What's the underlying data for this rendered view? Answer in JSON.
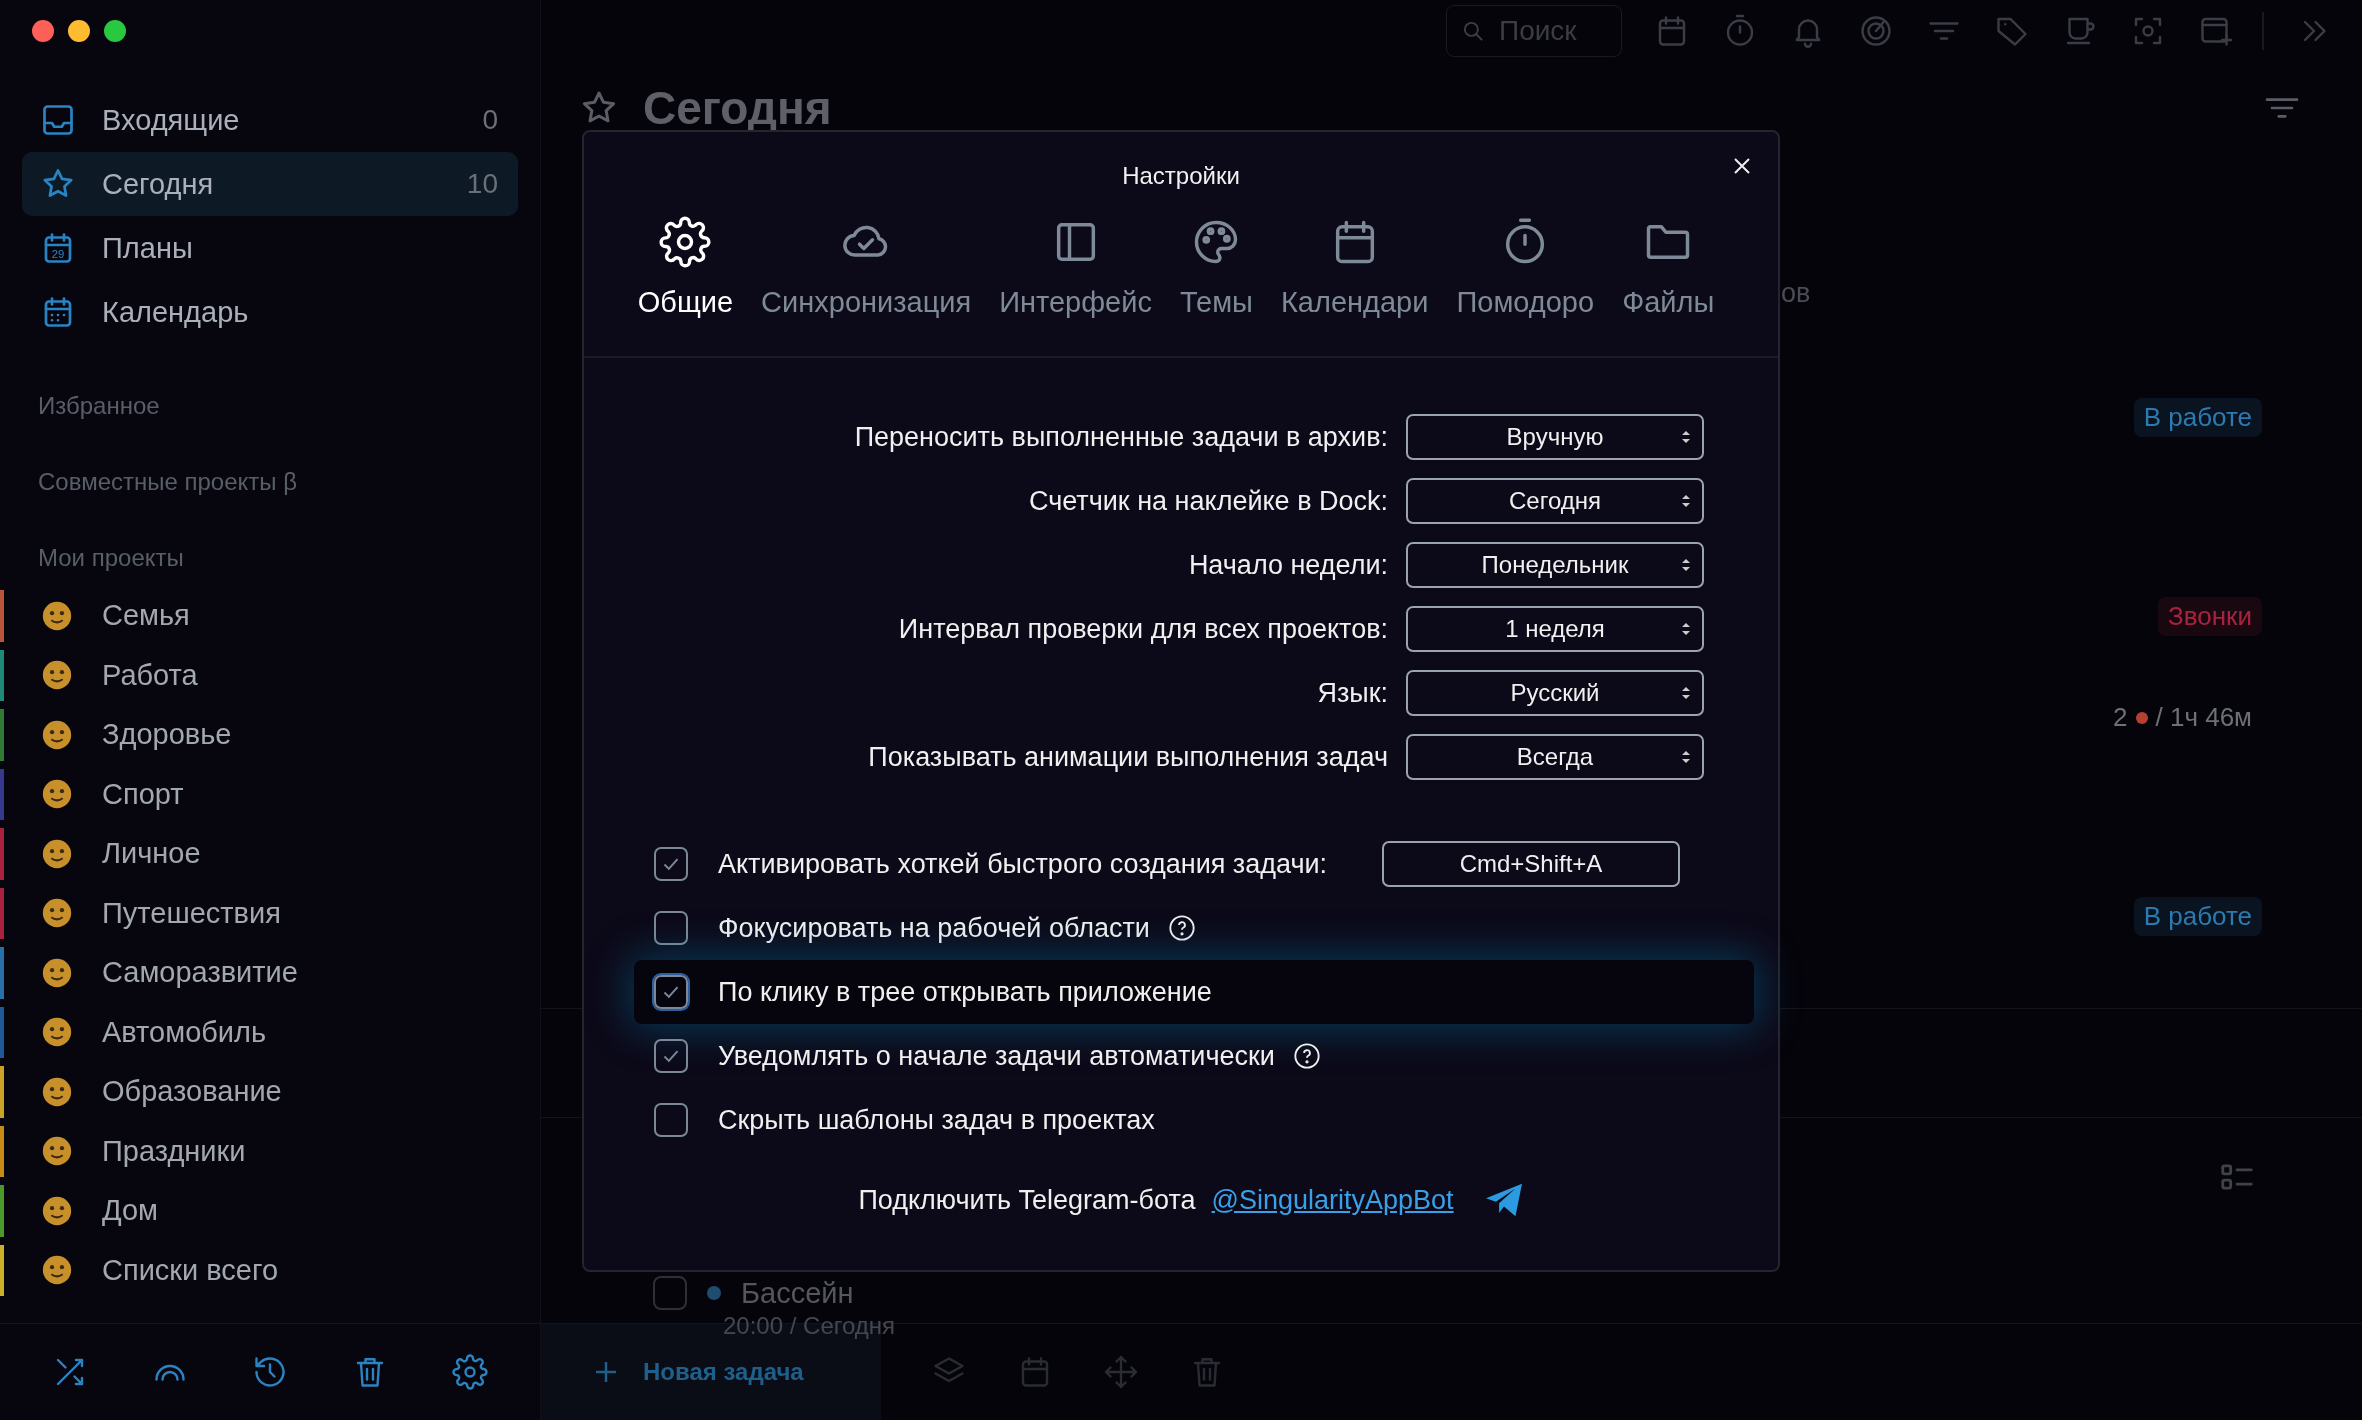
{
  "sidebar": {
    "nav": [
      {
        "kind": "inbox",
        "label": "Входящие",
        "count": "0",
        "selected": false
      },
      {
        "kind": "star",
        "label": "Сегодня",
        "count": "10",
        "selected": true
      },
      {
        "kind": "plans",
        "label": "Планы",
        "icon_text": "29",
        "selected": false
      },
      {
        "kind": "calendar",
        "label": "Календарь",
        "selected": false
      }
    ],
    "sections": [
      "Избранное",
      "Совместные проекты β"
    ],
    "projects_heading": "Мои проекты",
    "projects": [
      {
        "label": "Семья",
        "color": "#b8553a"
      },
      {
        "label": "Работа",
        "color": "#1f8a78"
      },
      {
        "label": "Здоровье",
        "color": "#2f7a34"
      },
      {
        "label": "Спорт",
        "color": "#353a90"
      },
      {
        "label": "Личное",
        "color": "#a8213f"
      },
      {
        "label": "Путешествия",
        "color": "#a8213f"
      },
      {
        "label": "Саморазвитие",
        "color": "#2a70a8"
      },
      {
        "label": "Автомобиль",
        "color": "#1f5a98"
      },
      {
        "label": "Образование",
        "color": "#c9a227"
      },
      {
        "label": "Праздники",
        "color": "#c98a17"
      },
      {
        "label": "Дом",
        "color": "#4a9a2a"
      },
      {
        "label": "Списки всего",
        "color": "#c9b227"
      }
    ]
  },
  "main": {
    "search": {
      "placeholder": "Поиск"
    },
    "header": {
      "title": "Сегодня"
    },
    "hidden_tab_fragment": "ов",
    "background": [
      {
        "kind": "tag",
        "text": "В работе",
        "color": "#2b7bb0"
      },
      {
        "kind": "tag",
        "text": "Звонки",
        "color": "#a8223f"
      },
      {
        "kind": "timer",
        "count": "2",
        "duration": "/ 1ч 46м",
        "color": "#b5402f"
      },
      {
        "kind": "tag",
        "text": "В работе",
        "color": "#2b7bb0"
      }
    ],
    "task": {
      "title": "Бассейн",
      "meta": "20:00 / Сегодня",
      "checked": false
    },
    "new_task_button": "Новая задача"
  },
  "settings": {
    "title": "Настройки",
    "tabs": [
      {
        "kind": "general",
        "label": "Общие",
        "selected": true
      },
      {
        "kind": "sync",
        "label": "Синхронизация",
        "selected": false
      },
      {
        "kind": "interface",
        "label": "Интерфейс",
        "selected": false
      },
      {
        "kind": "themes",
        "label": "Темы",
        "selected": false
      },
      {
        "kind": "calendars",
        "label": "Календари",
        "selected": false
      },
      {
        "kind": "pomodoro",
        "label": "Помодоро",
        "selected": false
      },
      {
        "kind": "files",
        "label": "Файлы",
        "selected": false
      }
    ],
    "selects": [
      {
        "label": "Переносить выполненные задачи в архив:",
        "value": "Вручную"
      },
      {
        "label": "Счетчик на наклейке в Dock:",
        "value": "Сегодня"
      },
      {
        "label": "Начало недели:",
        "value": "Понедельник"
      },
      {
        "label": "Интервал проверки для всех проектов:",
        "value": "1 неделя"
      },
      {
        "label": "Язык:",
        "value": "Русский"
      },
      {
        "label": "Показывать анимации выполнения задач",
        "value": "Всегда"
      }
    ],
    "checks": [
      {
        "label": "Активировать хоткей быстрого создания задачи:",
        "checked": true,
        "help": false,
        "highlighted": false,
        "hotkey": "Cmd+Shift+A"
      },
      {
        "label": "Фокусировать на рабочей области",
        "checked": false,
        "help": true,
        "highlighted": false
      },
      {
        "label": "По клику в трее открывать приложение",
        "checked": true,
        "help": false,
        "highlighted": true
      },
      {
        "label": "Уведомлять о начале задачи автоматически",
        "checked": true,
        "help": true,
        "highlighted": false
      },
      {
        "label": "Скрыть шаблоны задач в проектах",
        "checked": false,
        "help": false,
        "highlighted": false
      }
    ],
    "telegram": {
      "text": "Подключить Telegram-бота",
      "link": "@SingularityAppBot"
    }
  }
}
